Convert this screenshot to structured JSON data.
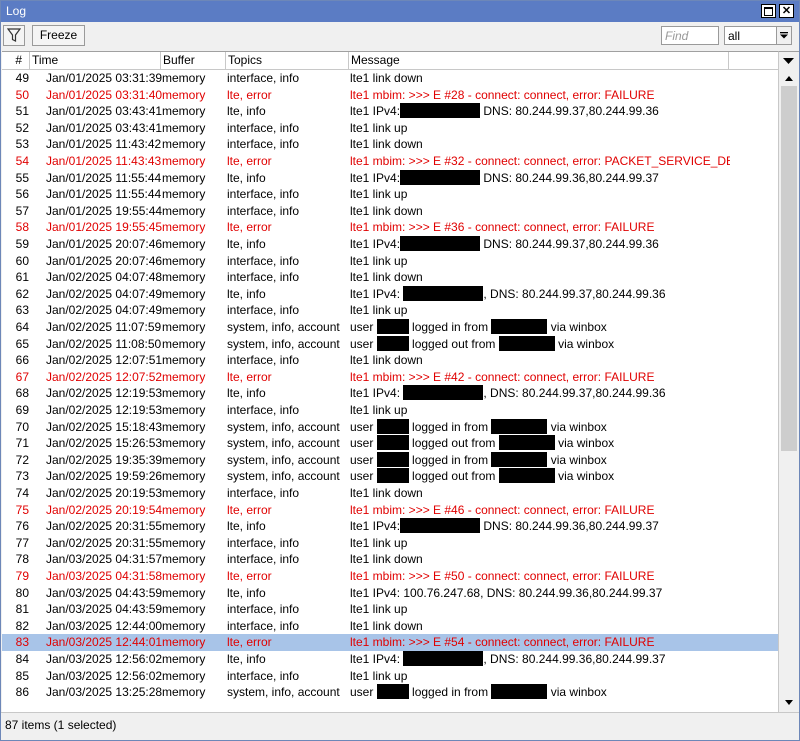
{
  "window": {
    "title": "Log"
  },
  "toolbar": {
    "freeze_label": "Freeze",
    "find_placeholder": "Find",
    "filter_value": "all"
  },
  "columns": [
    "#",
    "Time",
    "Buffer",
    "Topics",
    "Message"
  ],
  "rows": [
    {
      "n": "49",
      "time": "Jan/01/2025 03:31:39",
      "buf": "memory",
      "topics": "interface, info",
      "msg": [
        {
          "t": "lte1 link down"
        }
      ],
      "err": false
    },
    {
      "n": "50",
      "time": "Jan/01/2025 03:31:40",
      "buf": "memory",
      "topics": "lte, error",
      "msg": [
        {
          "t": "lte1 mbim: >>> E #28 - connect: connect, error: FAILURE"
        }
      ],
      "err": true
    },
    {
      "n": "51",
      "time": "Jan/01/2025 03:43:41",
      "buf": "memory",
      "topics": "lte, info",
      "msg": [
        {
          "t": "lte1 IPv4:"
        },
        {
          "r": 80
        },
        {
          "t": " DNS: 80.244.99.37,80.244.99.36"
        }
      ],
      "err": false
    },
    {
      "n": "52",
      "time": "Jan/01/2025 03:43:41",
      "buf": "memory",
      "topics": "interface, info",
      "msg": [
        {
          "t": "lte1 link up"
        }
      ],
      "err": false
    },
    {
      "n": "53",
      "time": "Jan/01/2025 11:43:42",
      "buf": "memory",
      "topics": "interface, info",
      "msg": [
        {
          "t": "lte1 link down"
        }
      ],
      "err": false
    },
    {
      "n": "54",
      "time": "Jan/01/2025 11:43:43",
      "buf": "memory",
      "topics": "lte, error",
      "msg": [
        {
          "t": "lte1 mbim: >>> E #32 - connect: connect, error: PACKET_SERVICE_DE..."
        }
      ],
      "err": true
    },
    {
      "n": "55",
      "time": "Jan/01/2025 11:55:44",
      "buf": "memory",
      "topics": "lte, info",
      "msg": [
        {
          "t": "lte1 IPv4:"
        },
        {
          "r": 80
        },
        {
          "t": " DNS: 80.244.99.36,80.244.99.37"
        }
      ],
      "err": false
    },
    {
      "n": "56",
      "time": "Jan/01/2025 11:55:44",
      "buf": "memory",
      "topics": "interface, info",
      "msg": [
        {
          "t": "lte1 link up"
        }
      ],
      "err": false
    },
    {
      "n": "57",
      "time": "Jan/01/2025 19:55:44",
      "buf": "memory",
      "topics": "interface, info",
      "msg": [
        {
          "t": "lte1 link down"
        }
      ],
      "err": false
    },
    {
      "n": "58",
      "time": "Jan/01/2025 19:55:45",
      "buf": "memory",
      "topics": "lte, error",
      "msg": [
        {
          "t": "lte1 mbim: >>> E #36 - connect: connect, error: FAILURE"
        }
      ],
      "err": true
    },
    {
      "n": "59",
      "time": "Jan/01/2025 20:07:46",
      "buf": "memory",
      "topics": "lte, info",
      "msg": [
        {
          "t": "lte1 IPv4:"
        },
        {
          "r": 80
        },
        {
          "t": " DNS: 80.244.99.37,80.244.99.36"
        }
      ],
      "err": false
    },
    {
      "n": "60",
      "time": "Jan/01/2025 20:07:46",
      "buf": "memory",
      "topics": "interface, info",
      "msg": [
        {
          "t": "lte1 link up"
        }
      ],
      "err": false
    },
    {
      "n": "61",
      "time": "Jan/02/2025 04:07:48",
      "buf": "memory",
      "topics": "interface, info",
      "msg": [
        {
          "t": "lte1 link down"
        }
      ],
      "err": false
    },
    {
      "n": "62",
      "time": "Jan/02/2025 04:07:49",
      "buf": "memory",
      "topics": "lte, info",
      "msg": [
        {
          "t": "lte1 IPv4: "
        },
        {
          "r": 80
        },
        {
          "t": ", DNS: 80.244.99.37,80.244.99.36"
        }
      ],
      "err": false
    },
    {
      "n": "63",
      "time": "Jan/02/2025 04:07:49",
      "buf": "memory",
      "topics": "interface, info",
      "msg": [
        {
          "t": "lte1 link up"
        }
      ],
      "err": false
    },
    {
      "n": "64",
      "time": "Jan/02/2025 11:07:59",
      "buf": "memory",
      "topics": "system, info, account",
      "msg": [
        {
          "t": "user "
        },
        {
          "r": 32
        },
        {
          "t": " logged in from "
        },
        {
          "r": 56
        },
        {
          "t": " via winbox"
        }
      ],
      "err": false
    },
    {
      "n": "65",
      "time": "Jan/02/2025 11:08:50",
      "buf": "memory",
      "topics": "system, info, account",
      "msg": [
        {
          "t": "user "
        },
        {
          "r": 32
        },
        {
          "t": " logged out from "
        },
        {
          "r": 56
        },
        {
          "t": " via winbox"
        }
      ],
      "err": false
    },
    {
      "n": "66",
      "time": "Jan/02/2025 12:07:51",
      "buf": "memory",
      "topics": "interface, info",
      "msg": [
        {
          "t": "lte1 link down"
        }
      ],
      "err": false
    },
    {
      "n": "67",
      "time": "Jan/02/2025 12:07:52",
      "buf": "memory",
      "topics": "lte, error",
      "msg": [
        {
          "t": "lte1 mbim: >>> E #42 - connect: connect, error: FAILURE"
        }
      ],
      "err": true
    },
    {
      "n": "68",
      "time": "Jan/02/2025 12:19:53",
      "buf": "memory",
      "topics": "lte, info",
      "msg": [
        {
          "t": "lte1 IPv4: "
        },
        {
          "r": 80
        },
        {
          "t": ", DNS: 80.244.99.37,80.244.99.36"
        }
      ],
      "err": false
    },
    {
      "n": "69",
      "time": "Jan/02/2025 12:19:53",
      "buf": "memory",
      "topics": "interface, info",
      "msg": [
        {
          "t": "lte1 link up"
        }
      ],
      "err": false
    },
    {
      "n": "70",
      "time": "Jan/02/2025 15:18:43",
      "buf": "memory",
      "topics": "system, info, account",
      "msg": [
        {
          "t": "user "
        },
        {
          "r": 32
        },
        {
          "t": " logged in from "
        },
        {
          "r": 56
        },
        {
          "t": " via winbox"
        }
      ],
      "err": false
    },
    {
      "n": "71",
      "time": "Jan/02/2025 15:26:53",
      "buf": "memory",
      "topics": "system, info, account",
      "msg": [
        {
          "t": "user "
        },
        {
          "r": 32
        },
        {
          "t": " logged out from "
        },
        {
          "r": 56
        },
        {
          "t": " via winbox"
        }
      ],
      "err": false
    },
    {
      "n": "72",
      "time": "Jan/02/2025 19:35:39",
      "buf": "memory",
      "topics": "system, info, account",
      "msg": [
        {
          "t": "user "
        },
        {
          "r": 32
        },
        {
          "t": " logged in from "
        },
        {
          "r": 56
        },
        {
          "t": " via winbox"
        }
      ],
      "err": false
    },
    {
      "n": "73",
      "time": "Jan/02/2025 19:59:26",
      "buf": "memory",
      "topics": "system, info, account",
      "msg": [
        {
          "t": "user "
        },
        {
          "r": 32
        },
        {
          "t": " logged out from "
        },
        {
          "r": 56
        },
        {
          "t": " via winbox"
        }
      ],
      "err": false
    },
    {
      "n": "74",
      "time": "Jan/02/2025 20:19:53",
      "buf": "memory",
      "topics": "interface, info",
      "msg": [
        {
          "t": "lte1 link down"
        }
      ],
      "err": false
    },
    {
      "n": "75",
      "time": "Jan/02/2025 20:19:54",
      "buf": "memory",
      "topics": "lte, error",
      "msg": [
        {
          "t": "lte1 mbim: >>> E #46 - connect: connect, error: FAILURE"
        }
      ],
      "err": true
    },
    {
      "n": "76",
      "time": "Jan/02/2025 20:31:55",
      "buf": "memory",
      "topics": "lte, info",
      "msg": [
        {
          "t": "lte1 IPv4:"
        },
        {
          "r": 80
        },
        {
          "t": " DNS: 80.244.99.36,80.244.99.37"
        }
      ],
      "err": false
    },
    {
      "n": "77",
      "time": "Jan/02/2025 20:31:55",
      "buf": "memory",
      "topics": "interface, info",
      "msg": [
        {
          "t": "lte1 link up"
        }
      ],
      "err": false
    },
    {
      "n": "78",
      "time": "Jan/03/2025 04:31:57",
      "buf": "memory",
      "topics": "interface, info",
      "msg": [
        {
          "t": "lte1 link down"
        }
      ],
      "err": false
    },
    {
      "n": "79",
      "time": "Jan/03/2025 04:31:58",
      "buf": "memory",
      "topics": "lte, error",
      "msg": [
        {
          "t": "lte1 mbim: >>> E #50 - connect: connect, error: FAILURE"
        }
      ],
      "err": true
    },
    {
      "n": "80",
      "time": "Jan/03/2025 04:43:59",
      "buf": "memory",
      "topics": "lte, info",
      "msg": [
        {
          "t": "lte1 IPv4: 100.76.247.68, DNS: 80.244.99.36,80.244.99.37"
        }
      ],
      "err": false
    },
    {
      "n": "81",
      "time": "Jan/03/2025 04:43:59",
      "buf": "memory",
      "topics": "interface, info",
      "msg": [
        {
          "t": "lte1 link up"
        }
      ],
      "err": false
    },
    {
      "n": "82",
      "time": "Jan/03/2025 12:44:00",
      "buf": "memory",
      "topics": "interface, info",
      "msg": [
        {
          "t": "lte1 link down"
        }
      ],
      "err": false
    },
    {
      "n": "83",
      "time": "Jan/03/2025 12:44:01",
      "buf": "memory",
      "topics": "lte, error",
      "msg": [
        {
          "t": "lte1 mbim: >>> E #54 - connect: connect, error: FAILURE"
        }
      ],
      "err": true,
      "selected": true
    },
    {
      "n": "84",
      "time": "Jan/03/2025 12:56:02",
      "buf": "memory",
      "topics": "lte, info",
      "msg": [
        {
          "t": "lte1 IPv4: "
        },
        {
          "r": 80
        },
        {
          "t": ", DNS: 80.244.99.36,80.244.99.37"
        }
      ],
      "err": false
    },
    {
      "n": "85",
      "time": "Jan/03/2025 12:56:02",
      "buf": "memory",
      "topics": "interface, info",
      "msg": [
        {
          "t": "lte1 link up"
        }
      ],
      "err": false
    },
    {
      "n": "86",
      "time": "Jan/03/2025 13:25:28",
      "buf": "memory",
      "topics": "system, info, account",
      "msg": [
        {
          "t": "user "
        },
        {
          "r": 32
        },
        {
          "t": " logged in from "
        },
        {
          "r": 56
        },
        {
          "t": " via winbox"
        }
      ],
      "err": false
    }
  ],
  "status": {
    "text": "87 items (1 selected)"
  },
  "colors": {
    "error_text": "#e00000",
    "selected_row": "#a8c4e8",
    "titlebar": "#5b7cc4"
  },
  "icons": {
    "filter": "funnel-icon",
    "maximize": "maximize-icon",
    "close": "close-icon"
  }
}
